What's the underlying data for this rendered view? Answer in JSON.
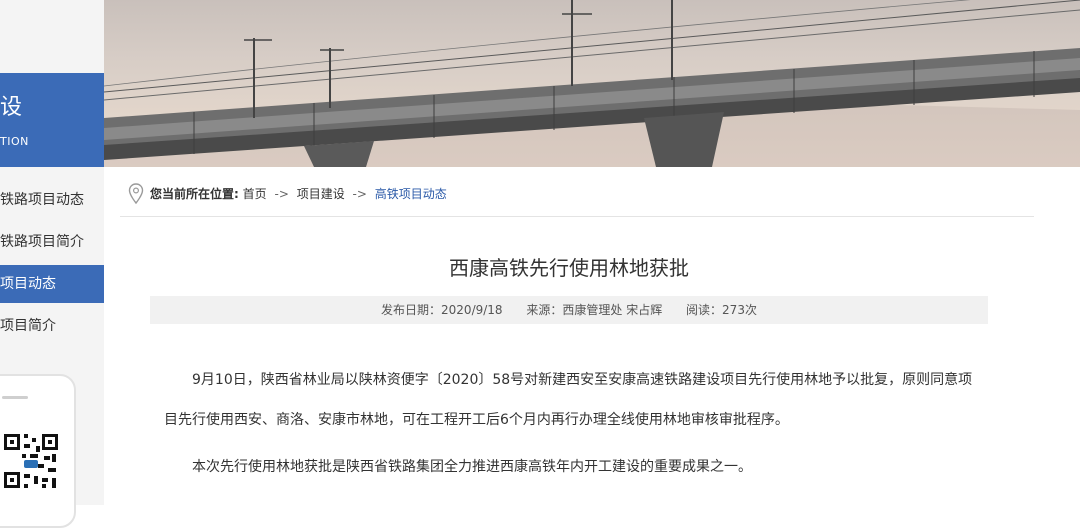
{
  "sidebar": {
    "title": "设",
    "subtitle": "TION",
    "items": [
      {
        "label": "铁路项目动态",
        "active": false
      },
      {
        "label": "铁路项目简介",
        "active": false
      },
      {
        "label": "项目动态",
        "active": true
      },
      {
        "label": "项目简介",
        "active": false
      }
    ],
    "qr_icon": "qr-code-icon"
  },
  "breadcrumb": {
    "label": "您当前所在位置:",
    "home": "首页",
    "sep": "->",
    "section": "项目建设",
    "current": "高铁项目动态"
  },
  "article": {
    "title": "西康高铁先行使用林地获批",
    "meta": {
      "date": "发布日期：2020/9/18",
      "source": "来源：西康管理处 宋占辉",
      "views": "阅读：273次"
    },
    "paragraphs": [
      "9月10日，陕西省林业局以陕林资便字〔2020〕58号对新建西安至安康高速铁路建设项目先行使用林地予以批复，原则同意项目先行使用西安、商洛、安康市林地，可在工程开工后6个月内再行办理全线使用林地审核审批程序。",
      "本次先行使用林地获批是陕西省铁路集团全力推进西康高铁年内开工建设的重要成果之一。"
    ]
  },
  "colors": {
    "accent": "#3b6bb7",
    "link": "#2b5aa8",
    "meta_bg": "#f1f1f1"
  }
}
